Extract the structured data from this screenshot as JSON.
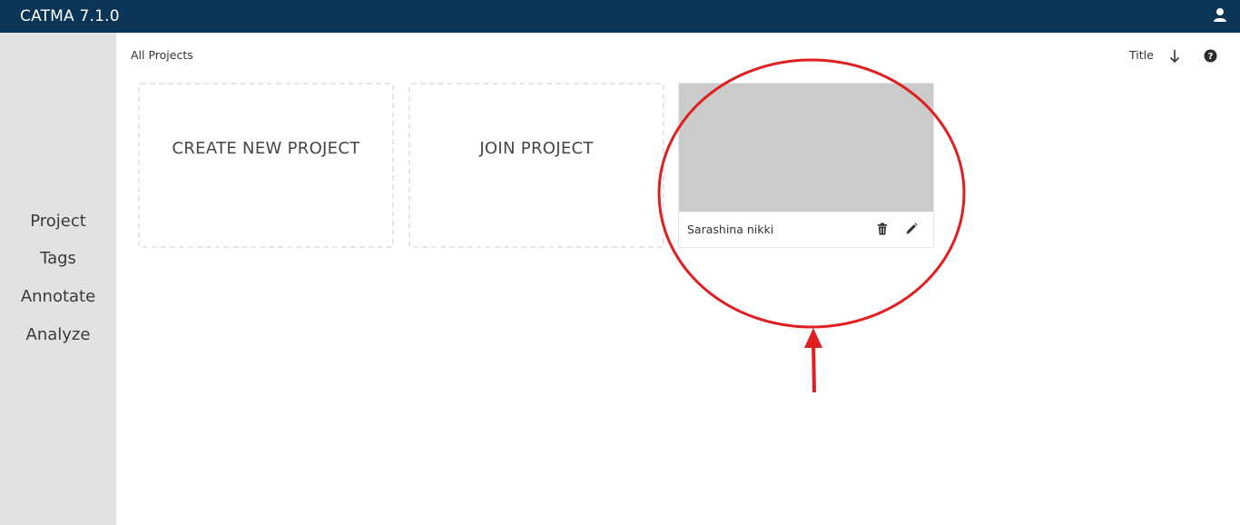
{
  "app": {
    "title": "CATMA 7.1.0"
  },
  "header": {
    "user_icon": "user-icon"
  },
  "sidebar": {
    "items": [
      {
        "label": "Project"
      },
      {
        "label": "Tags"
      },
      {
        "label": "Annotate"
      },
      {
        "label": "Analyze"
      }
    ]
  },
  "toolbar": {
    "breadcrumb": "All Projects",
    "sort_label": "Title",
    "sort_icon": "arrow-down-icon",
    "help_icon": "question-circle-icon"
  },
  "tiles": {
    "create_label": "CREATE NEW PROJECT",
    "join_label": "JOIN PROJECT"
  },
  "project": {
    "name": "Sarashina nikki",
    "delete_icon": "trash-icon",
    "edit_icon": "pencil-icon"
  },
  "colors": {
    "topbar": "#0a3556",
    "sidebar": "#e2e2e2",
    "thumbnail": "#cbcbcb",
    "annotation": "#e02020"
  }
}
